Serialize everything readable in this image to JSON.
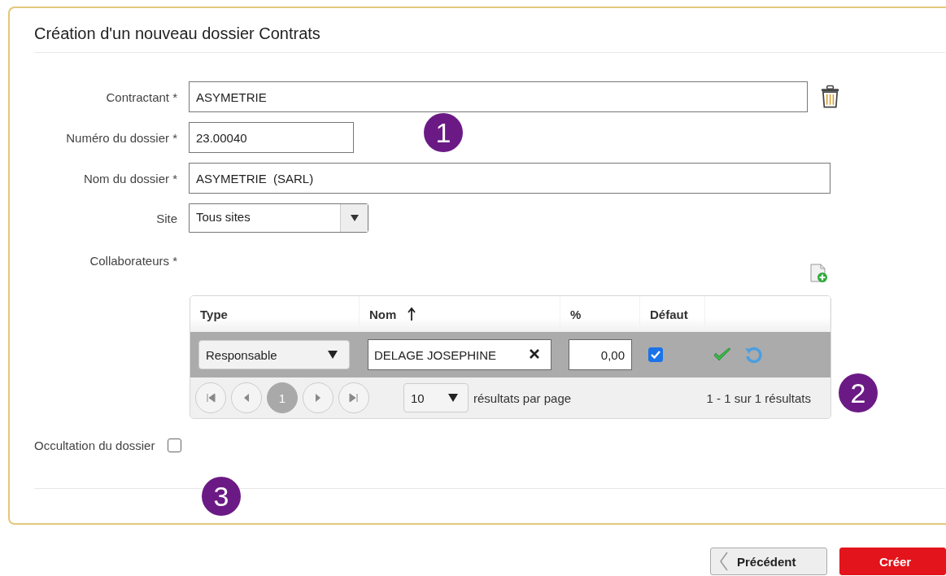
{
  "title": "Création d'un nouveau dossier Contrats",
  "fields": [
    {
      "label": "Contractant *",
      "kind": "text",
      "value": "ASYMETRIE",
      "deletable": true
    },
    {
      "label": "Numéro du dossier *",
      "kind": "short_text",
      "value": "23.00040",
      "deletable": false
    },
    {
      "label": "Nom du dossier *",
      "kind": "text",
      "value": "ASYMETRIE  (SARL)",
      "deletable": false
    },
    {
      "label": "Site",
      "kind": "select",
      "value": "Tous sites",
      "deletable": false
    }
  ],
  "collaborators": {
    "label": "Collaborateurs *",
    "columns": [
      {
        "label": "Type",
        "sorted": false
      },
      {
        "label": "Nom",
        "sorted": true
      },
      {
        "label": "%",
        "sorted": false
      },
      {
        "label": "Défaut",
        "sorted": false
      }
    ],
    "rows": [
      {
        "type": "Responsable",
        "name": "DELAGE JOSEPHINE",
        "percent": "0,00",
        "default": true
      }
    ],
    "pager": {
      "page": "1",
      "page_size": "10",
      "page_size_label": "résultats par page",
      "summary": "1 - 1 sur 1 résultats"
    }
  },
  "occultation": {
    "label": "Occultation du dossier",
    "checked": false
  },
  "badges": [
    "1",
    "2",
    "3"
  ],
  "buttons": [
    {
      "label": "Précédent",
      "kind": "secondary"
    },
    {
      "label": "Créer",
      "kind": "primary"
    }
  ]
}
